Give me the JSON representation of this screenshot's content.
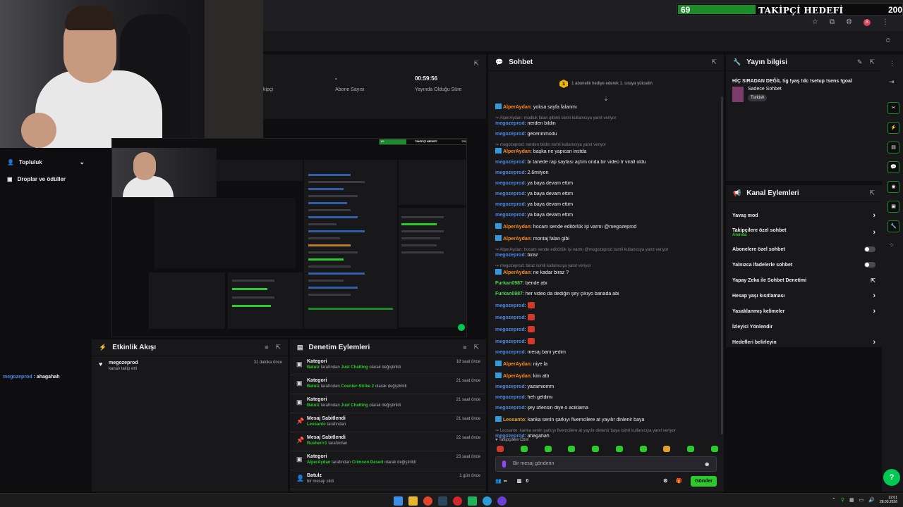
{
  "goal": {
    "current": "69",
    "label": "TAKİPÇİ HEDEFİ",
    "max": "200",
    "progress_fraction": 0.345
  },
  "stats": {
    "items": [
      {
        "value": "",
        "label": "kipçi"
      },
      {
        "value": "-",
        "label": "Abone Sayısı"
      },
      {
        "value": "00:59:56",
        "label": "Yayında Olduğu Süre"
      }
    ]
  },
  "sidebar": {
    "items": [
      {
        "label": "Topluluk",
        "icon": "people-icon"
      },
      {
        "label": "Droplar ve ödüller",
        "icon": "gift-icon"
      }
    ],
    "chat_user": "megozeprod",
    "chat_text": " : ahagahah"
  },
  "nested": {
    "goal_cur": "69",
    "goal_label": "TAKİPÇİ HEDEFİ",
    "goal_max": "200"
  },
  "activity": {
    "title": "Etkinlik Akışı",
    "items": [
      {
        "name": "megozeprod",
        "sub": "kanalı takip etti",
        "time": "31 dakika önce"
      }
    ]
  },
  "modlog": {
    "title": "Denetim Eylemleri",
    "items": [
      {
        "icon": "category-icon",
        "title": "Kategori",
        "actor": "Batulz",
        "mid": " tarafından ",
        "target": "Just Chatting",
        "tail": " olarak değiştirildi",
        "time": "18 saat önce"
      },
      {
        "icon": "category-icon",
        "title": "Kategori",
        "actor": "Batulz",
        "mid": " tarafından ",
        "target": "Counter-Strike 2",
        "tail": " olarak değiştirildi",
        "time": "21 saat önce"
      },
      {
        "icon": "category-icon",
        "title": "Kategori",
        "actor": "Batulz",
        "mid": " tarafından ",
        "target": "Just Chatting",
        "tail": " olarak değiştirildi",
        "time": "21 saat önce"
      },
      {
        "icon": "pin-icon",
        "title": "Mesaj Sabitlendi",
        "actor": "Leosanto",
        "mid": " tarafından",
        "target": "",
        "tail": "",
        "time": "21 saat önce"
      },
      {
        "icon": "pin-icon",
        "title": "Mesaj Sabitlendi",
        "actor": "Rusherrr1",
        "mid": " tarafından",
        "target": "",
        "tail": "",
        "time": "22 saat önce"
      },
      {
        "icon": "category-icon",
        "title": "Kategori",
        "actor": "AlperAydan",
        "mid": " tarafından ",
        "target": "Crimson Desert",
        "tail": " olarak değiştirildi",
        "time": "23 saat önce"
      },
      {
        "icon": "user-icon",
        "title": "Batulz",
        "actor": "",
        "mid": "bir mesajı sildi",
        "target": "",
        "tail": "",
        "time": "1 gün önce"
      }
    ]
  },
  "chat": {
    "title": "Sohbet",
    "pinned": "1 abonelik hediye ederek 1. sıraya yükselin",
    "messages": [
      {
        "type": "msg",
        "badge": true,
        "user": "AlperAydan",
        "color": "orange",
        "text": ": yoksa sayfa falanmı"
      },
      {
        "type": "reply",
        "text": "AlperAydan: modluk falan gibimi isimli kullanıcıya yanıt veriyor"
      },
      {
        "type": "msg",
        "badge": false,
        "user": "megozeprod",
        "color": "blue",
        "text": ": nerden bildin"
      },
      {
        "type": "msg",
        "badge": false,
        "user": "megozeprod",
        "color": "blue",
        "text": ": geceninmodu"
      },
      {
        "type": "reply",
        "text": "megozeprod: nerden bildin isimli kullanıcıya yanıt veriyor"
      },
      {
        "type": "msg",
        "badge": true,
        "user": "AlperAydan",
        "color": "orange",
        "text": ": başka ne yapıcan instda"
      },
      {
        "type": "msg",
        "badge": false,
        "user": "megozeprod",
        "color": "blue",
        "text": ": bı tanede rap sayfası açtım onda bir video tr virall oldu"
      },
      {
        "type": "msg",
        "badge": false,
        "user": "megozeprod",
        "color": "blue",
        "text": ": 2.6milyon"
      },
      {
        "type": "msg",
        "badge": false,
        "user": "megozeprod",
        "color": "blue",
        "text": ": ya baya devam ettim"
      },
      {
        "type": "msg",
        "badge": false,
        "user": "megozeprod",
        "color": "blue",
        "text": ": ya baya devam ettim"
      },
      {
        "type": "msg",
        "badge": false,
        "user": "megozeprod",
        "color": "blue",
        "text": ": ya baya devam ettim"
      },
      {
        "type": "msg",
        "badge": false,
        "user": "megozeprod",
        "color": "blue",
        "text": ": ya baya devam ettim"
      },
      {
        "type": "msg",
        "badge": true,
        "user": "AlperAydan",
        "color": "orange",
        "text": ": hocam sende editörlük işi varmı @megozeprod"
      },
      {
        "type": "msg",
        "badge": true,
        "user": "AlperAydan",
        "color": "orange",
        "text": ": montaj falan gibi"
      },
      {
        "type": "reply",
        "text": "AlperAydan: hocam sende editörlük işi varmı @megozeprod isimli kullanıcıya yanıt veriyor"
      },
      {
        "type": "msg",
        "badge": false,
        "user": "megozeprod",
        "color": "blue",
        "text": ": biraz"
      },
      {
        "type": "reply",
        "text": "megozeprod: biraz isimli kullanıcıya yanıt veriyor"
      },
      {
        "type": "msg",
        "badge": true,
        "user": "AlperAydan",
        "color": "orange",
        "text": ": ne kadar biraz ?"
      },
      {
        "type": "msg",
        "badge": false,
        "user": "Furkan0987",
        "color": "green",
        "text": ": bende abi"
      },
      {
        "type": "msg",
        "badge": false,
        "user": "Furkan0987",
        "color": "green",
        "text": ": her video da dediğin şey çıkıyo banada abi"
      },
      {
        "type": "emote",
        "user": "megozeprod",
        "color": "blue",
        "text": ": "
      },
      {
        "type": "emote",
        "user": "megozeprod",
        "color": "blue",
        "text": ": "
      },
      {
        "type": "emote",
        "user": "megozeprod",
        "color": "blue",
        "text": ": "
      },
      {
        "type": "emote",
        "user": "megozeprod",
        "color": "blue",
        "text": ": "
      },
      {
        "type": "msg",
        "badge": false,
        "user": "megozeprod",
        "color": "blue",
        "text": ": mesaj bani yedim"
      },
      {
        "type": "msg",
        "badge": true,
        "user": "AlperAydan",
        "color": "orange",
        "text": ": niye la"
      },
      {
        "type": "msg",
        "badge": true,
        "user": "AlperAydan",
        "color": "orange",
        "text": ": kim attı"
      },
      {
        "type": "msg",
        "badge": false,
        "user": "megozeprod",
        "color": "blue",
        "text": ": yazamiomm"
      },
      {
        "type": "msg",
        "badge": false,
        "user": "megozeprod",
        "color": "blue",
        "text": ": heh geldimi"
      },
      {
        "type": "msg",
        "badge": false,
        "user": "megozeprod",
        "color": "blue",
        "text": ": şey izlensin diye o aciklama"
      },
      {
        "type": "msg",
        "badge": true,
        "user": "Leosanto",
        "color": "gold",
        "text": ": kanka senin şarkıyı fivemcilere at yayılır dinlenir baya"
      },
      {
        "type": "reply",
        "text": "Leosanto: kanka senin şarkıyı fivemcilere at yayılır dinlenir baya isimli kullanıcıya yanıt veriyor"
      },
      {
        "type": "msg",
        "badge": false,
        "user": "megozeprod",
        "color": "blue",
        "text": ": ahagahah"
      }
    ],
    "followers_only": "Takipçilere Özel",
    "input_placeholder": "Bir mesaj gönderin",
    "infinity": "∞",
    "count": "0",
    "send_label": "Gönder"
  },
  "streaminfo": {
    "title": "Yayın bilgisi",
    "stream_title": "HİÇ SIRADAN DEĞİL !ig !yaş !dc !setup !sens !goal",
    "category": "Sadece Sohbet",
    "tag": "Turkish"
  },
  "actions": {
    "title": "Kanal Eylemleri",
    "rows": [
      {
        "label": "Yavaş mod",
        "control": "chevron",
        "sub": ""
      },
      {
        "label": "Takipçilere özel sohbet",
        "control": "chevron",
        "sub": "Anında"
      },
      {
        "label": "Abonelere özel sohbet",
        "control": "toggle",
        "sub": ""
      },
      {
        "label": "Yalnızca ifadelerle sohbet",
        "control": "toggle",
        "sub": ""
      },
      {
        "label": "Yapay Zeka ile Sohbet Denetimi",
        "control": "external",
        "sub": ""
      },
      {
        "label": "Hesap yaşı kısıtlaması",
        "control": "chevron",
        "sub": ""
      },
      {
        "label": "Yasaklanmış kelimeler",
        "control": "chevron",
        "sub": ""
      },
      {
        "label": "İzleyici Yönlendir",
        "control": "none",
        "sub": ""
      },
      {
        "label": "Hedefleri belirleyin",
        "control": "chevron",
        "sub": ""
      }
    ]
  },
  "taskbar": {
    "time": "22:01",
    "date": "28.03.2026"
  }
}
